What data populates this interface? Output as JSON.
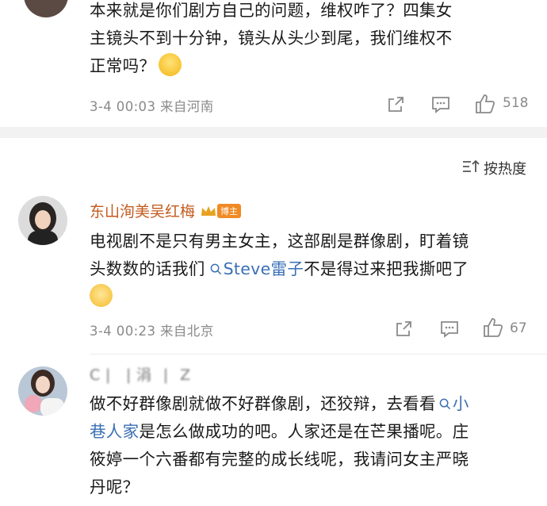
{
  "comment1": {
    "line1": "本来就是你们剧方自己的问题，维权咋了？四集女",
    "line2": "主镜头不到十分钟，镜头从头少到尾，我们维权不",
    "line3": "正常吗？",
    "meta": "3-4 00:03  来自河南",
    "likes": "518"
  },
  "sort": {
    "icon": "sort-icon",
    "label": "按热度"
  },
  "comment2": {
    "username": "东山洵美吴红梅",
    "badge": "博主",
    "line1": "电视剧不是只有男主女主，这部剧是群像剧，盯着镜",
    "line2_pre": "头数数的话我们",
    "mention": "Steve雷子",
    "line2_post": "不是得过来把我撕吧了",
    "meta": "3-4 00:23  来自北京",
    "likes": "67"
  },
  "comment3": {
    "username": "C❘ ❘涓 ❘ Z",
    "line1_pre": "做不好群像剧就做不好群像剧，还狡辩，去看看",
    "mention_a": "小",
    "line2_mention": "巷人家",
    "line2_post": "是怎么做成功的吧。人家还是在芒果播呢。庄",
    "line3": "筱婷一个六番都有完整的成长线呢，我请问女主严晓",
    "line4": "丹呢？"
  },
  "colors": {
    "accent": "#3a6fb5",
    "username": "#c45a1d",
    "meta": "#8a8a8a",
    "separator": "#f2f2f2"
  }
}
